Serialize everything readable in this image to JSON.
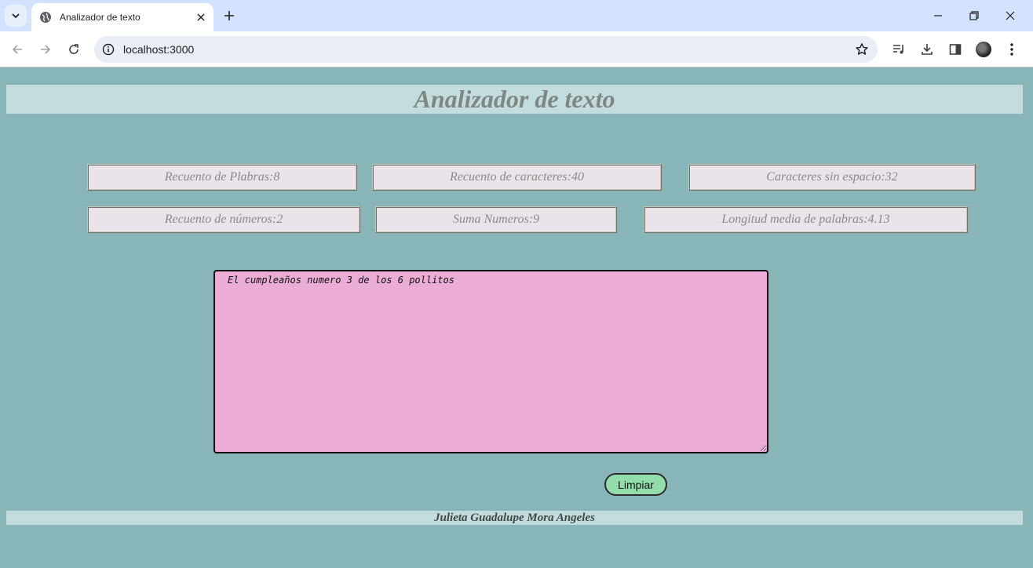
{
  "browser": {
    "tab_title": "Analizador de texto",
    "url": "localhost:3000"
  },
  "page": {
    "title": "Analizador de texto",
    "stats": {
      "word_count": "Recuento de Plabras:8",
      "char_count": "Recuento de caracteres:40",
      "chars_no_space": "Caracteres sin espacio:32",
      "number_count": "Recuento de números:2",
      "number_sum": "Suma Numeros:9",
      "avg_word_length": "Longitud media de palabras:4.13"
    },
    "input_text": "El cumpleaños numero 3 de los 6 pollitos",
    "clear_label": "Limpiar",
    "author": "Julieta Guadalupe Mora Angeles"
  },
  "colors": {
    "page_background": "#88b6b8",
    "header_background": "#c3dcdd",
    "stat_background": "#ebe3ea",
    "textarea_background": "#ebacd6",
    "button_background": "#93dcab"
  },
  "icons": [
    "tab-search-icon",
    "globe-icon",
    "close-icon",
    "plus-icon",
    "minimize-icon",
    "restore-icon",
    "back-icon",
    "forward-icon",
    "reload-icon",
    "site-info-icon",
    "star-icon",
    "media-icon",
    "download-icon",
    "sidepanel-icon",
    "profile-avatar",
    "menu-icon"
  ]
}
